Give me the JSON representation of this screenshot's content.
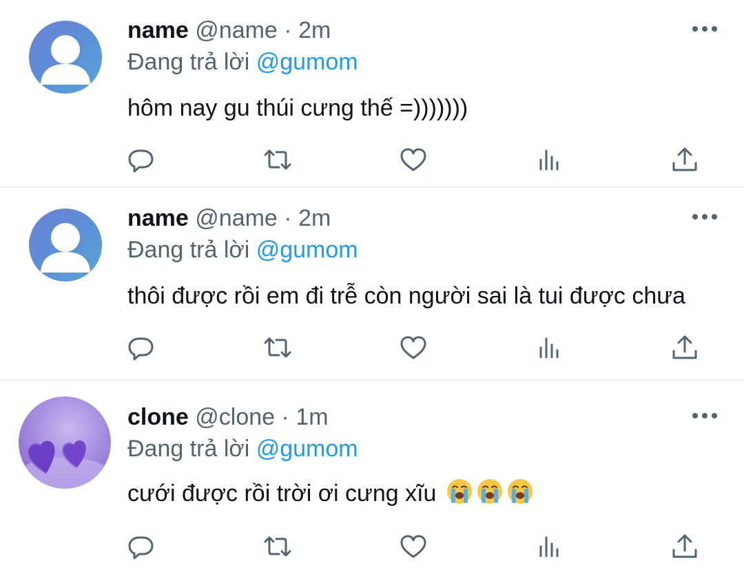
{
  "feed": {
    "tweets": [
      {
        "name": "name",
        "handle": "@name",
        "separator": " · ",
        "time": "2m",
        "reply_prefix": "Đang trả lời ",
        "reply_to": "@gumom",
        "text": "hôm nay gu thúi cưng thế =)))))))",
        "avatar_icon": "default-profile-icon"
      },
      {
        "name": "name",
        "handle": "@name",
        "separator": " · ",
        "time": "2m",
        "reply_prefix": "Đang trả lời ",
        "reply_to": "@gumom",
        "text": "thôi được rồi em đi trễ còn người sai là tui được chưa",
        "avatar_icon": "default-profile-icon"
      },
      {
        "name": "clone",
        "handle": "@clone",
        "separator": " · ",
        "time": "1m",
        "reply_prefix": "Đang trả lời ",
        "reply_to": "@gumom",
        "text": "cưới được rồi trời ơi cưng xĩu",
        "emojis": [
          "loudly-crying-face",
          "loudly-crying-face",
          "loudly-crying-face"
        ],
        "avatar_icon": "purple-hearts-photo"
      }
    ]
  },
  "colors": {
    "text": "#0f1419",
    "secondary": "#536471",
    "mention": "#1d9bf0",
    "divider": "#eff3f4"
  },
  "icons": [
    "reply-icon",
    "retweet-icon",
    "like-icon",
    "views-icon",
    "share-icon",
    "more-icon"
  ]
}
